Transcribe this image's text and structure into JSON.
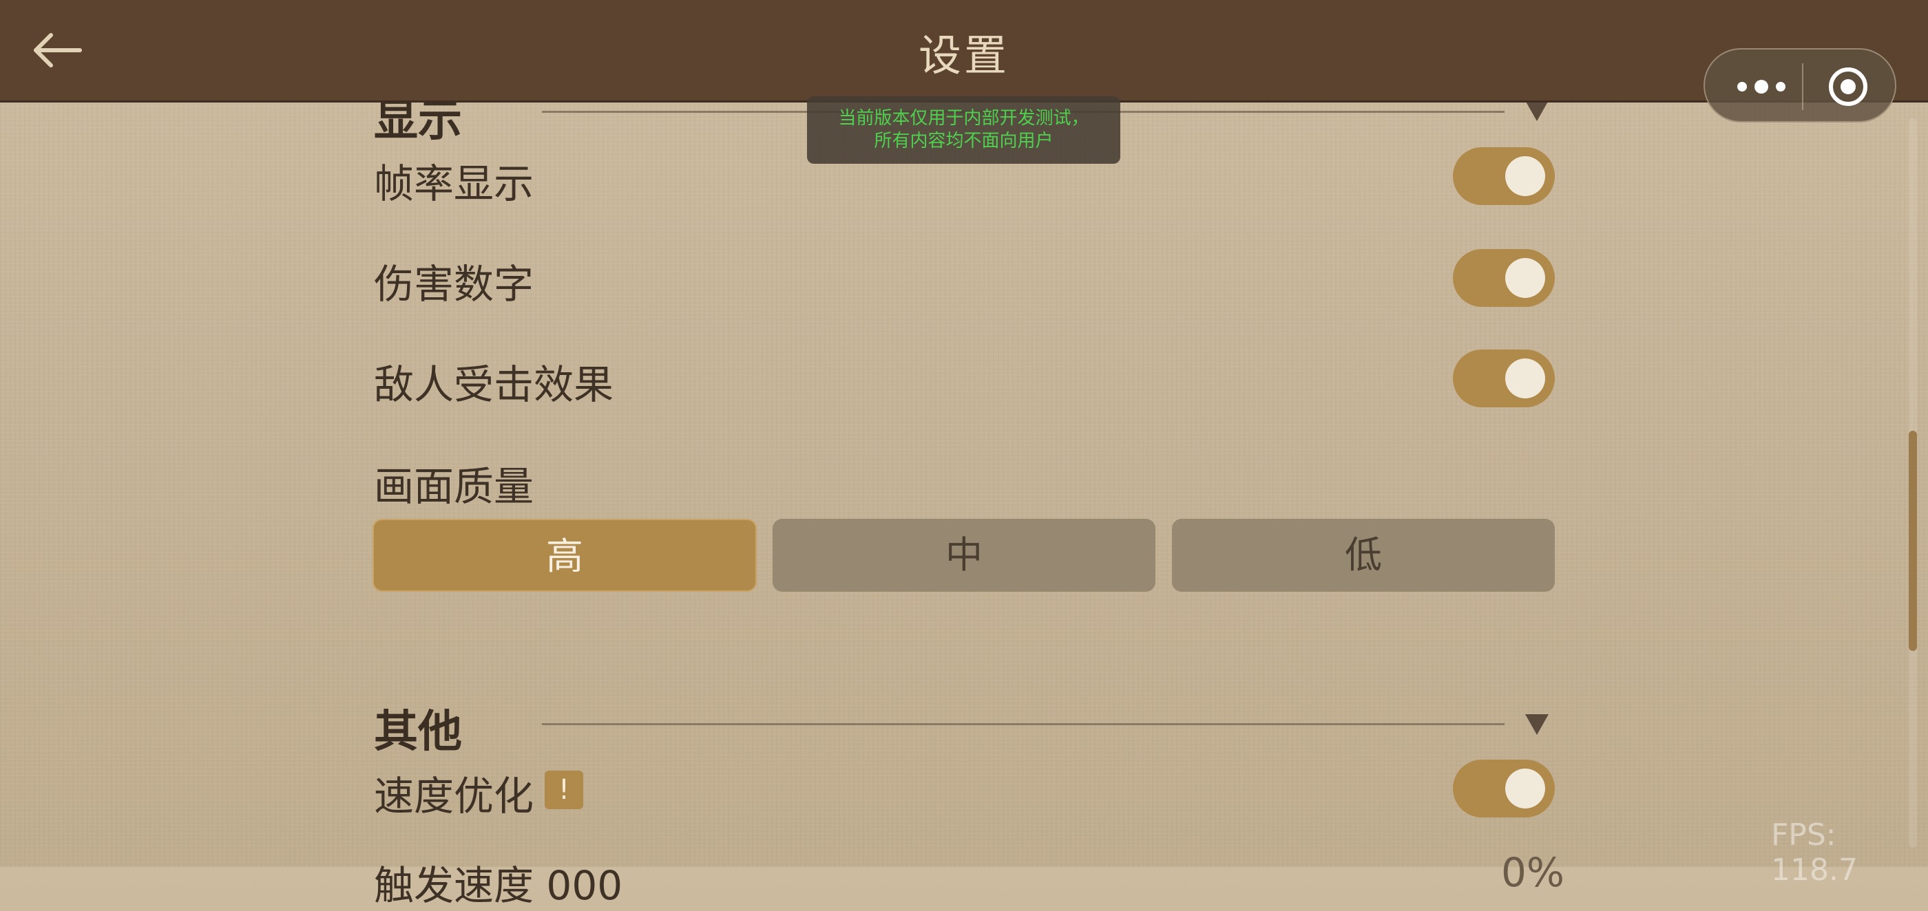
{
  "header": {
    "title": "设置",
    "back_icon": "arrow-left-icon",
    "menu_icons": [
      "more-dots-icon",
      "close-target-icon"
    ]
  },
  "toast": {
    "line1": "当前版本仅用于内部开发测试，",
    "line2": "所有内容均不面向用户"
  },
  "sections": {
    "display": {
      "title": "显示",
      "items": [
        {
          "label": "帧率显示",
          "on": true
        },
        {
          "label": "伤害数字",
          "on": true
        },
        {
          "label": "敌人受击效果",
          "on": true
        }
      ],
      "quality": {
        "label": "画面质量",
        "options": [
          "高",
          "中",
          "低"
        ],
        "selected": "高"
      }
    },
    "other": {
      "title": "其他",
      "items": [
        {
          "label": "速度优化",
          "badge": "!",
          "on": true
        }
      ],
      "partial_row": {
        "label": "触发速度 000",
        "value": "0%"
      }
    }
  },
  "overlay": {
    "fps": "FPS: 118.7"
  },
  "colors": {
    "header_bg": "#5c4330",
    "accent": "#b08a4a",
    "toast_text": "#4fd04f",
    "button_inactive": "#978971"
  }
}
